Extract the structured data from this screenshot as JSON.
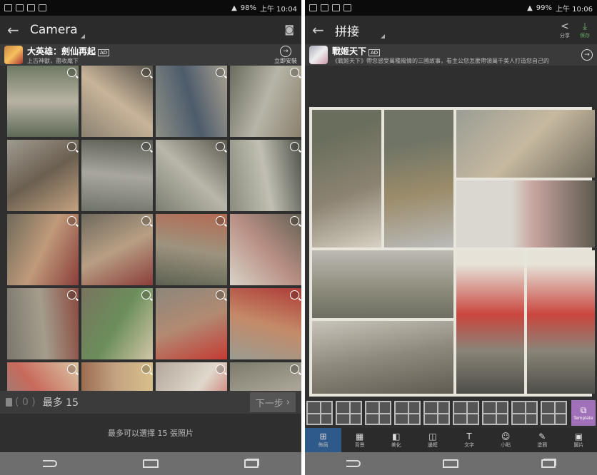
{
  "left": {
    "status": {
      "battery": "98%",
      "time": "上午 10:04"
    },
    "appbar": {
      "title": "Camera"
    },
    "ad": {
      "title": "大英雄：劍仙再起",
      "badge": "AD",
      "subtitle": "上古神獸，盡收麾下",
      "action": "立即安裝"
    },
    "photos": [
      "p1",
      "p2",
      "p3",
      "p4",
      "p5",
      "p6",
      "p7",
      "p8",
      "p9",
      "p10",
      "p11",
      "p12",
      "p13",
      "p14",
      "p15",
      "p16",
      "p17",
      "p18",
      "p19",
      "p20"
    ],
    "selection": {
      "count": "( 0 )",
      "max_label": "最多 15",
      "next_label": "下一步"
    },
    "hint": "最多可以選擇 15 張照片"
  },
  "right": {
    "status": {
      "battery": "99%",
      "time": "上午 10:06"
    },
    "appbar": {
      "title": "拼接",
      "share_label": "分享",
      "save_label": "保存"
    },
    "ad": {
      "title": "戰姬天下",
      "badge": "AD",
      "subtitle": "《戰姬天下》帶您感受萬種風情的三國故事，看主公您怎麼帶領萬千美人打造您自己的"
    },
    "template_label": "Template",
    "tools": [
      {
        "glyph": "⊞",
        "label": "佈局"
      },
      {
        "glyph": "▦",
        "label": "背景"
      },
      {
        "glyph": "◧",
        "label": "美化"
      },
      {
        "glyph": "◫",
        "label": "邊框"
      },
      {
        "glyph": "T",
        "label": "文字"
      },
      {
        "glyph": "☺",
        "label": "小貼"
      },
      {
        "glyph": "✎",
        "label": "塗鴉"
      },
      {
        "glyph": "▣",
        "label": "圖片"
      }
    ]
  }
}
